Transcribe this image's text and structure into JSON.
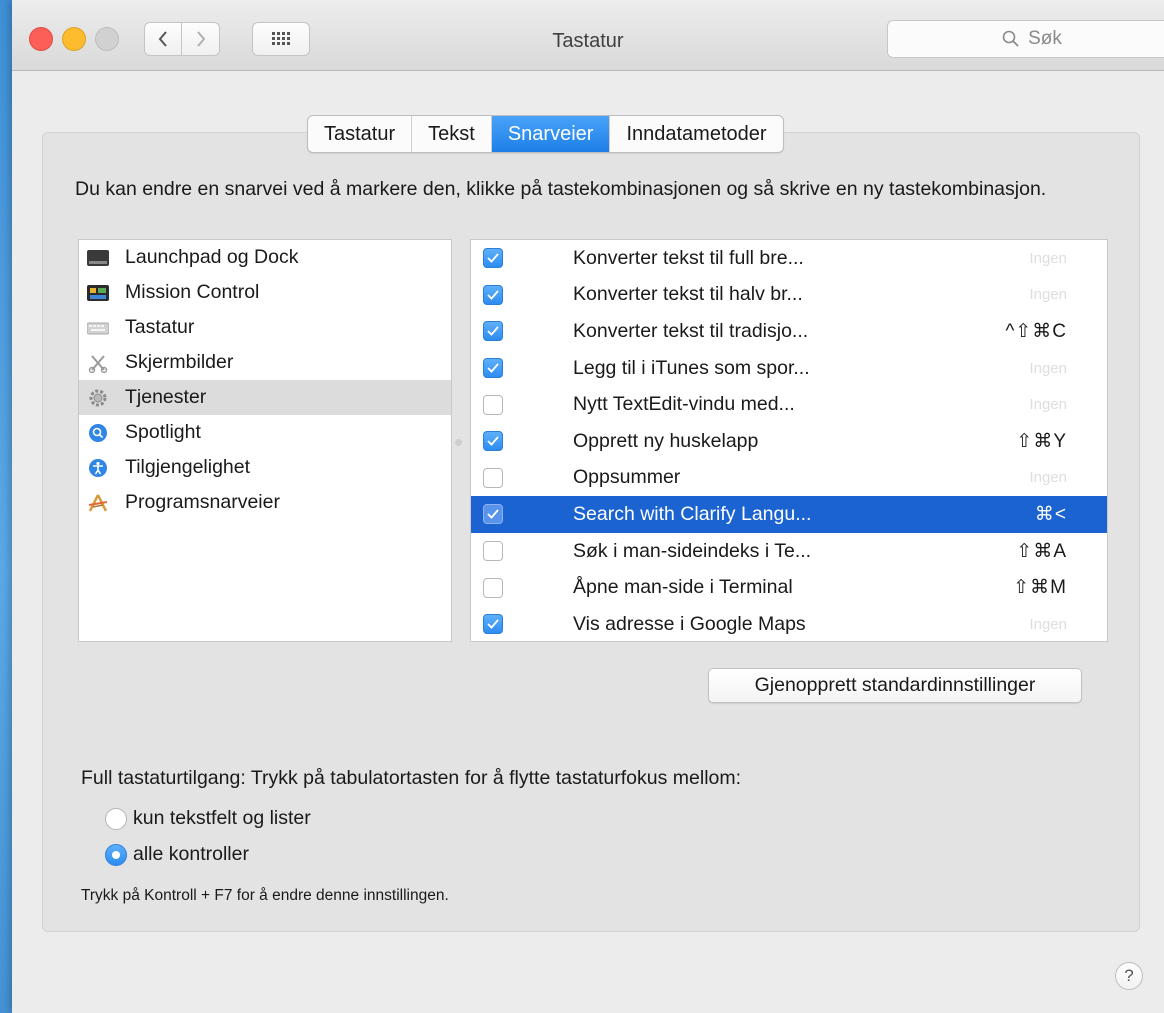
{
  "window": {
    "title": "Tastatur",
    "search_placeholder": "Søk"
  },
  "tabs": [
    {
      "label": "Tastatur",
      "active": false
    },
    {
      "label": "Tekst",
      "active": false
    },
    {
      "label": "Snarveier",
      "active": true
    },
    {
      "label": "Inndatametoder",
      "active": false
    }
  ],
  "description": "Du kan endre en snarvei ved å markere den, klikke på tastekombinasjonen og så skrive en ny tastekombinasjon.",
  "categories": [
    {
      "label": "Launchpad og Dock",
      "icon": "launchpad-dock-icon",
      "selected": false
    },
    {
      "label": "Mission Control",
      "icon": "mission-control-icon",
      "selected": false
    },
    {
      "label": "Tastatur",
      "icon": "keyboard-icon",
      "selected": false
    },
    {
      "label": "Skjermbilder",
      "icon": "screenshot-icon",
      "selected": false
    },
    {
      "label": "Tjenester",
      "icon": "gear-icon",
      "selected": true
    },
    {
      "label": "Spotlight",
      "icon": "spotlight-icon",
      "selected": false
    },
    {
      "label": "Tilgjengelighet",
      "icon": "accessibility-icon",
      "selected": false
    },
    {
      "label": "Programsnarveier",
      "icon": "app-shortcuts-icon",
      "selected": false
    }
  ],
  "shortcuts": [
    {
      "label": "Konverter tekst til full bre...",
      "checked": true,
      "key": "Ingen",
      "none": true
    },
    {
      "label": "Konverter tekst til halv br...",
      "checked": true,
      "key": "Ingen",
      "none": true
    },
    {
      "label": "Konverter tekst til tradisjo...",
      "checked": true,
      "key": "^⇧⌘C",
      "none": false
    },
    {
      "label": "Legg til i iTunes som spor...",
      "checked": true,
      "key": "Ingen",
      "none": true
    },
    {
      "label": "Nytt TextEdit-vindu med...",
      "checked": false,
      "key": "Ingen",
      "none": true
    },
    {
      "label": "Opprett ny huskelapp",
      "checked": true,
      "key": "⇧⌘Y",
      "none": false
    },
    {
      "label": "Oppsummer",
      "checked": false,
      "key": "Ingen",
      "none": true
    },
    {
      "label": "Search with Clarify Langu...",
      "checked": true,
      "key": "⌘<",
      "none": false,
      "selected": true
    },
    {
      "label": "Søk i man-sideindeks i Te...",
      "checked": false,
      "key": "⇧⌘A",
      "none": false
    },
    {
      "label": "Åpne man-side i Terminal",
      "checked": false,
      "key": "⇧⌘M",
      "none": false
    },
    {
      "label": "Vis adresse i Google Maps",
      "checked": true,
      "key": "Ingen",
      "none": true
    }
  ],
  "restore_button": "Gjenopprett standardinnstillinger",
  "full_access": {
    "label": "Full tastaturtilgang: Trykk på tabulatortasten for å flytte tastaturfokus mellom:",
    "options": [
      {
        "label": "kun tekstfelt og lister",
        "selected": false
      },
      {
        "label": "alle kontroller",
        "selected": true
      }
    ],
    "hint": "Trykk på Kontroll + F7 for å endre denne innstillingen."
  },
  "help_label": "?",
  "colors": {
    "accent": "#1d7fe8",
    "selection": "#1a63d1"
  }
}
